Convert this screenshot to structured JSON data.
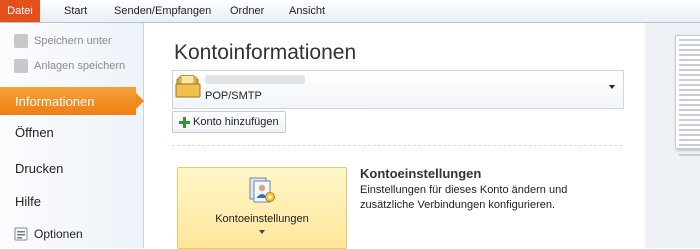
{
  "ribbon": {
    "tabs": [
      "Datei",
      "Start",
      "Senden/Empfangen",
      "Ordner",
      "Ansicht"
    ]
  },
  "sidebar": {
    "save_as": "Speichern unter",
    "save_attachments": "Anlagen speichern",
    "items": [
      "Informationen",
      "Öffnen",
      "Drucken",
      "Hilfe"
    ],
    "options": "Optionen"
  },
  "main": {
    "title": "Kontoinformationen",
    "account": {
      "protocol": "POP/SMTP"
    },
    "add_account": "Konto hinzufügen",
    "settings_button": "Kontoeinstellungen",
    "settings_title": "Kontoeinstellungen",
    "settings_desc": "Einstellungen für dieses Konto ändern und zusätzliche Verbindungen konfigurieren."
  },
  "colors": {
    "accent": "#ef8a18",
    "file_tab": "#e3501c"
  }
}
